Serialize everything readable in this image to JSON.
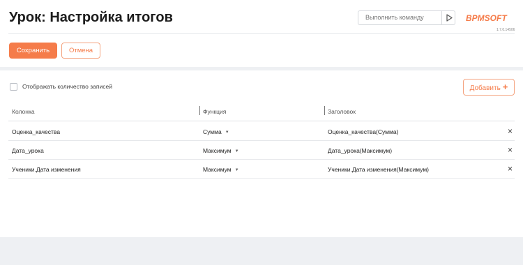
{
  "header": {
    "title": "Урок: Настройка итогов",
    "command_placeholder": "Выполнить команду",
    "logo_text": "BPMSOFT",
    "version": "1.7.0.14506"
  },
  "toolbar": {
    "save_label": "Сохранить",
    "cancel_label": "Отмена"
  },
  "settings": {
    "show_count_label": "Отображать количество записей",
    "show_count_checked": false,
    "add_label": "Добавить",
    "add_icon": "+"
  },
  "table": {
    "headers": [
      "Колонка",
      "Функция",
      "Заголовок"
    ],
    "rows": [
      {
        "column": "Оценка_качества",
        "function": "Сумма",
        "title": "Оценка_качества(Сумма)"
      },
      {
        "column": "Дата_урока",
        "function": "Максимум",
        "title": "Дата_урока(Максимум)"
      },
      {
        "column": "Ученики.Дата изменения",
        "function": "Максимум",
        "title": "Ученики.Дата изменения(Максимум)"
      }
    ],
    "delete_icon": "×",
    "caret_icon": "▼"
  },
  "colors": {
    "accent": "#f57c4a",
    "accent_border": "#f4a37f",
    "background": "#eef0f3"
  }
}
